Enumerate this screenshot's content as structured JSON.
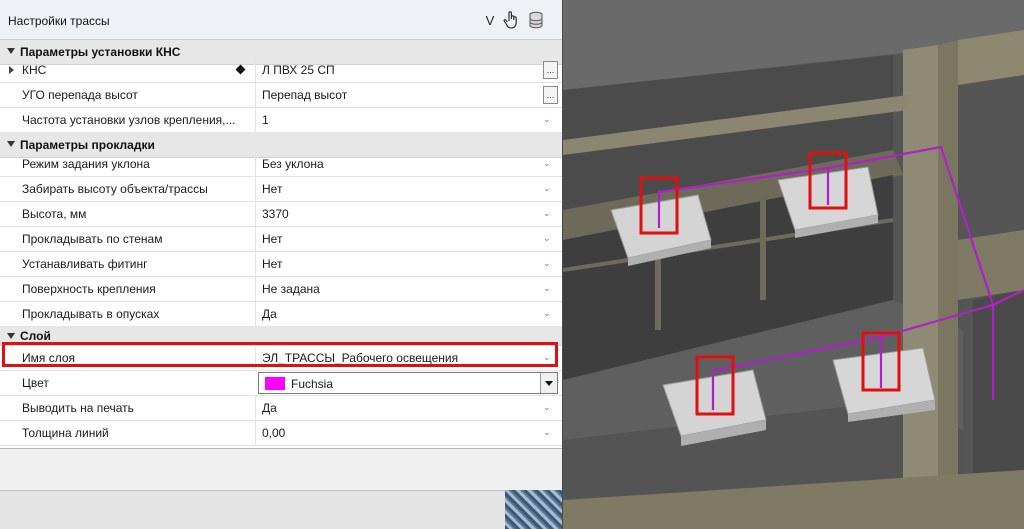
{
  "window": {
    "title": "Настройки трассы",
    "toolbar": {
      "v_label": "V"
    }
  },
  "categories": [
    {
      "label": "Параметры установки КНС"
    },
    {
      "label": "Параметры прокладки"
    },
    {
      "label": "Слой"
    }
  ],
  "properties": {
    "kns": {
      "name": "КНС",
      "value": "Л ПВХ 25 СП",
      "button": "..."
    },
    "ugo": {
      "name": "УГО перепада высот",
      "value": "Перепад высот",
      "button": "..."
    },
    "freq": {
      "name": "Частота установки узлов крепления,...",
      "value": "1"
    },
    "slope_mode": {
      "name": "Режим задания уклона",
      "value": "Без уклона"
    },
    "take_height": {
      "name": "Забирать высоту объекта/трассы",
      "value": "Нет"
    },
    "height": {
      "name": "Высота, мм",
      "value": "3370"
    },
    "along_walls": {
      "name": "Прокладывать по стенам",
      "value": "Нет"
    },
    "fitting": {
      "name": "Устанавливать фитинг",
      "value": "Нет"
    },
    "surface": {
      "name": "Поверхность крепления",
      "value": "Не задана"
    },
    "drops": {
      "name": "Прокладывать в опусках",
      "value": "Да"
    },
    "layer_name": {
      "name": "Имя слоя",
      "value": "ЭЛ_ТРАССЫ_Рабочего освещения"
    },
    "color": {
      "name": "Цвет",
      "value": "Fuchsia",
      "swatch": "#FF00FF"
    },
    "print": {
      "name": "Выводить на печать",
      "value": "Да"
    },
    "line_width": {
      "name": "Толщина линий",
      "value": "0,00"
    }
  },
  "colors": {
    "highlight": "#E01010",
    "route": "#B020C8",
    "marker": "#E01010"
  },
  "icons": [
    "filter-v-icon",
    "hand-pointer-icon",
    "database-icon",
    "chevron-down-icon",
    "ellipsis-button-icon",
    "diamond-icon"
  ]
}
